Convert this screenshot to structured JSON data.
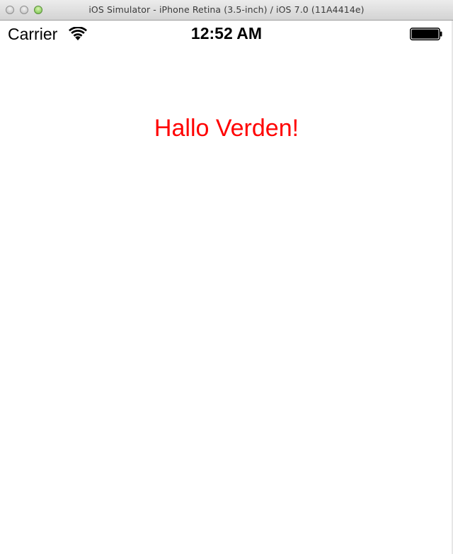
{
  "window": {
    "title": "iOS Simulator - iPhone Retina (3.5-inch) / iOS 7.0 (11A4414e)"
  },
  "status_bar": {
    "carrier": "Carrier",
    "time": "12:52 AM",
    "wifi_icon": "wifi-icon",
    "battery_icon": "battery-icon",
    "battery_level": 1.0
  },
  "content": {
    "greeting": "Hallo Verden!",
    "greeting_color": "#ff0000"
  }
}
